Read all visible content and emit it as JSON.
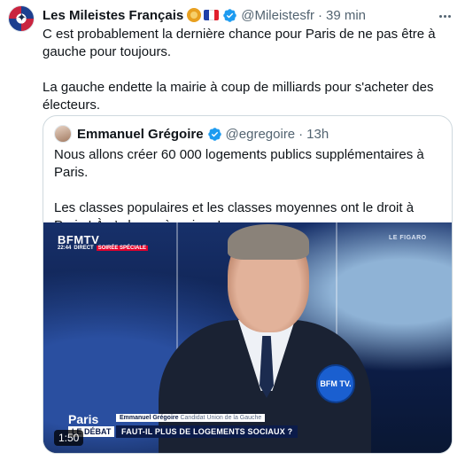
{
  "tweet": {
    "author_name": "Les Mileistes Français",
    "author_emojis": [
      "lion-emoji",
      "french-flag-emoji"
    ],
    "handle": "@Mileistesfr",
    "separator": "·",
    "time": "39 min",
    "paragraphs": [
      "C est probablement la dernière chance pour Paris de ne pas être à gauche pour toujours.",
      "La gauche endette la mairie à coup de milliards pour s'acheter des électeurs."
    ]
  },
  "quote": {
    "author_name": "Emmanuel Grégoire",
    "handle": "@egregoire",
    "separator": "·",
    "time": "13h",
    "paragraphs": [
      "Nous allons créer 60 000 logements publics supplémentaires à Paris.",
      "Les classes populaires et les classes moyennes ont le droit à Paris ! À s’y loger, à y vivre !"
    ],
    "video": {
      "channel": "BFMTV",
      "clock": "22:44",
      "live_tag": "DIRECT",
      "program_tag": "SOIRÉE SPÉCIALE",
      "partner": "LE FIGARO",
      "mic_label": "BFM TV.",
      "lower_third_name": "Emmanuel Grégoire",
      "lower_third_role": "Candidat Union de la Gauche",
      "lower_third_question": "FAUT-IL PLUS DE LOGEMENTS SOCIAUX ?",
      "show_label": "Paris",
      "show_sub": "LE DÉBAT",
      "duration": "1:50"
    }
  },
  "colors": {
    "verified_blue": "#1d9bf0",
    "muted_text": "#536471",
    "border": "#cfd9de",
    "bfm_red": "#e4002b"
  },
  "icons": {
    "verified": "verified-badge-icon",
    "more": "more-options-icon"
  }
}
